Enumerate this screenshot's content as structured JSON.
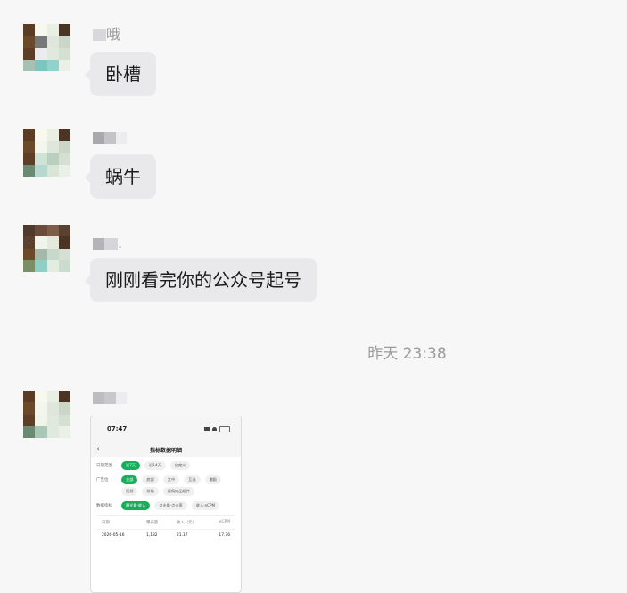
{
  "messages": [
    {
      "sender_suffix": "哦",
      "text": "卧槽"
    },
    {
      "sender_suffix": "",
      "text": "蜗牛"
    },
    {
      "sender_suffix": ".",
      "text": "刚刚看完你的公众号起号"
    }
  ],
  "timestamp": "昨天 23:38",
  "image_message": {
    "status_time": "07:47",
    "page_title": "指标数据明细",
    "filters": [
      {
        "label": "日期范围",
        "chips": [
          "近7天",
          "近14天",
          "自定义"
        ],
        "active": "近7天"
      },
      {
        "label": "广告位",
        "chips": [
          "全部",
          "底部",
          "文中",
          "互选",
          "激励",
          "视频",
          "前贴",
          "返佣商品组件"
        ],
        "active": "全部"
      },
      {
        "label": "数据指标",
        "chips": [
          "曝光量·收入",
          "点击量·点击率",
          "收入·eCPM"
        ],
        "active": "曝光量·收入"
      }
    ],
    "table": {
      "headers": [
        "日期",
        "曝光量",
        "收入（元）",
        "eCPM"
      ],
      "rows": [
        [
          "2026-05-16",
          "1,182",
          "21.17",
          "17.76"
        ]
      ]
    }
  },
  "colors": {
    "bubble": "#e9e9eb",
    "accent": "#1aad5b",
    "background": "#f7f7f7"
  }
}
